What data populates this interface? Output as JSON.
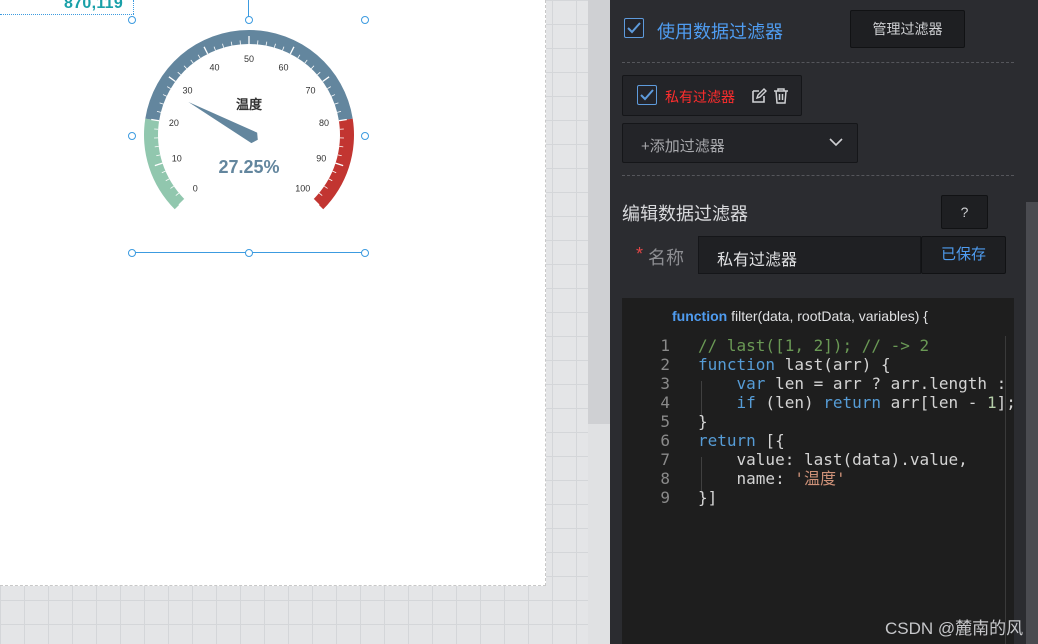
{
  "canvas": {
    "coord_readout": "870,119",
    "gauge": {
      "title": "温度",
      "value_text": "27.25%",
      "value": 27.25,
      "min": 0,
      "max": 100,
      "tick_labels": [
        "0",
        "10",
        "20",
        "30",
        "40",
        "50",
        "60",
        "70",
        "80",
        "90",
        "100"
      ],
      "colors": {
        "low": "#91c7ae",
        "mid": "#63869e",
        "high": "#c23531",
        "pointer": "#63869e",
        "value_text": "#63869e"
      }
    }
  },
  "panel": {
    "use_filter_label": "使用数据过滤器",
    "use_filter_checked": true,
    "manage_filter_button": "管理过滤器",
    "filter_chip": {
      "label": "私有过滤器",
      "checked": true,
      "edit_icon": "edit-icon",
      "delete_icon": "trash-icon"
    },
    "add_filter_select": {
      "value": "+添加过滤器",
      "icon": "chevron-down-icon"
    },
    "edit_section_title": "编辑数据过滤器",
    "help_button": "?",
    "name_required_mark": "*",
    "name_label": "名称",
    "name_value": "私有过滤器",
    "saved_button": "已保存",
    "editor": {
      "fn_keyword": "function",
      "fn_signature": "filter(data, rootData, variables) {",
      "lines": [
        {
          "n": "1",
          "text": "// last([1, 2]); // -> 2"
        },
        {
          "n": "2",
          "text": "function last(arr) {"
        },
        {
          "n": "3",
          "text": "    var len = arr ? arr.length :"
        },
        {
          "n": "4",
          "text": "    if (len) return arr[len - 1];"
        },
        {
          "n": "5",
          "text": "}"
        },
        {
          "n": "6",
          "text": "return [{"
        },
        {
          "n": "7",
          "text": "    value: last(data).value,"
        },
        {
          "n": "8",
          "text": "    name: '温度'"
        },
        {
          "n": "9",
          "text": "}]"
        }
      ]
    }
  },
  "watermark": "CSDN @麓南的风",
  "colors": {
    "accent": "#4f9cf0",
    "danger": "#ff2d2d",
    "panel_bg": "#2b2c30",
    "editor_bg": "#1e1e1e"
  }
}
